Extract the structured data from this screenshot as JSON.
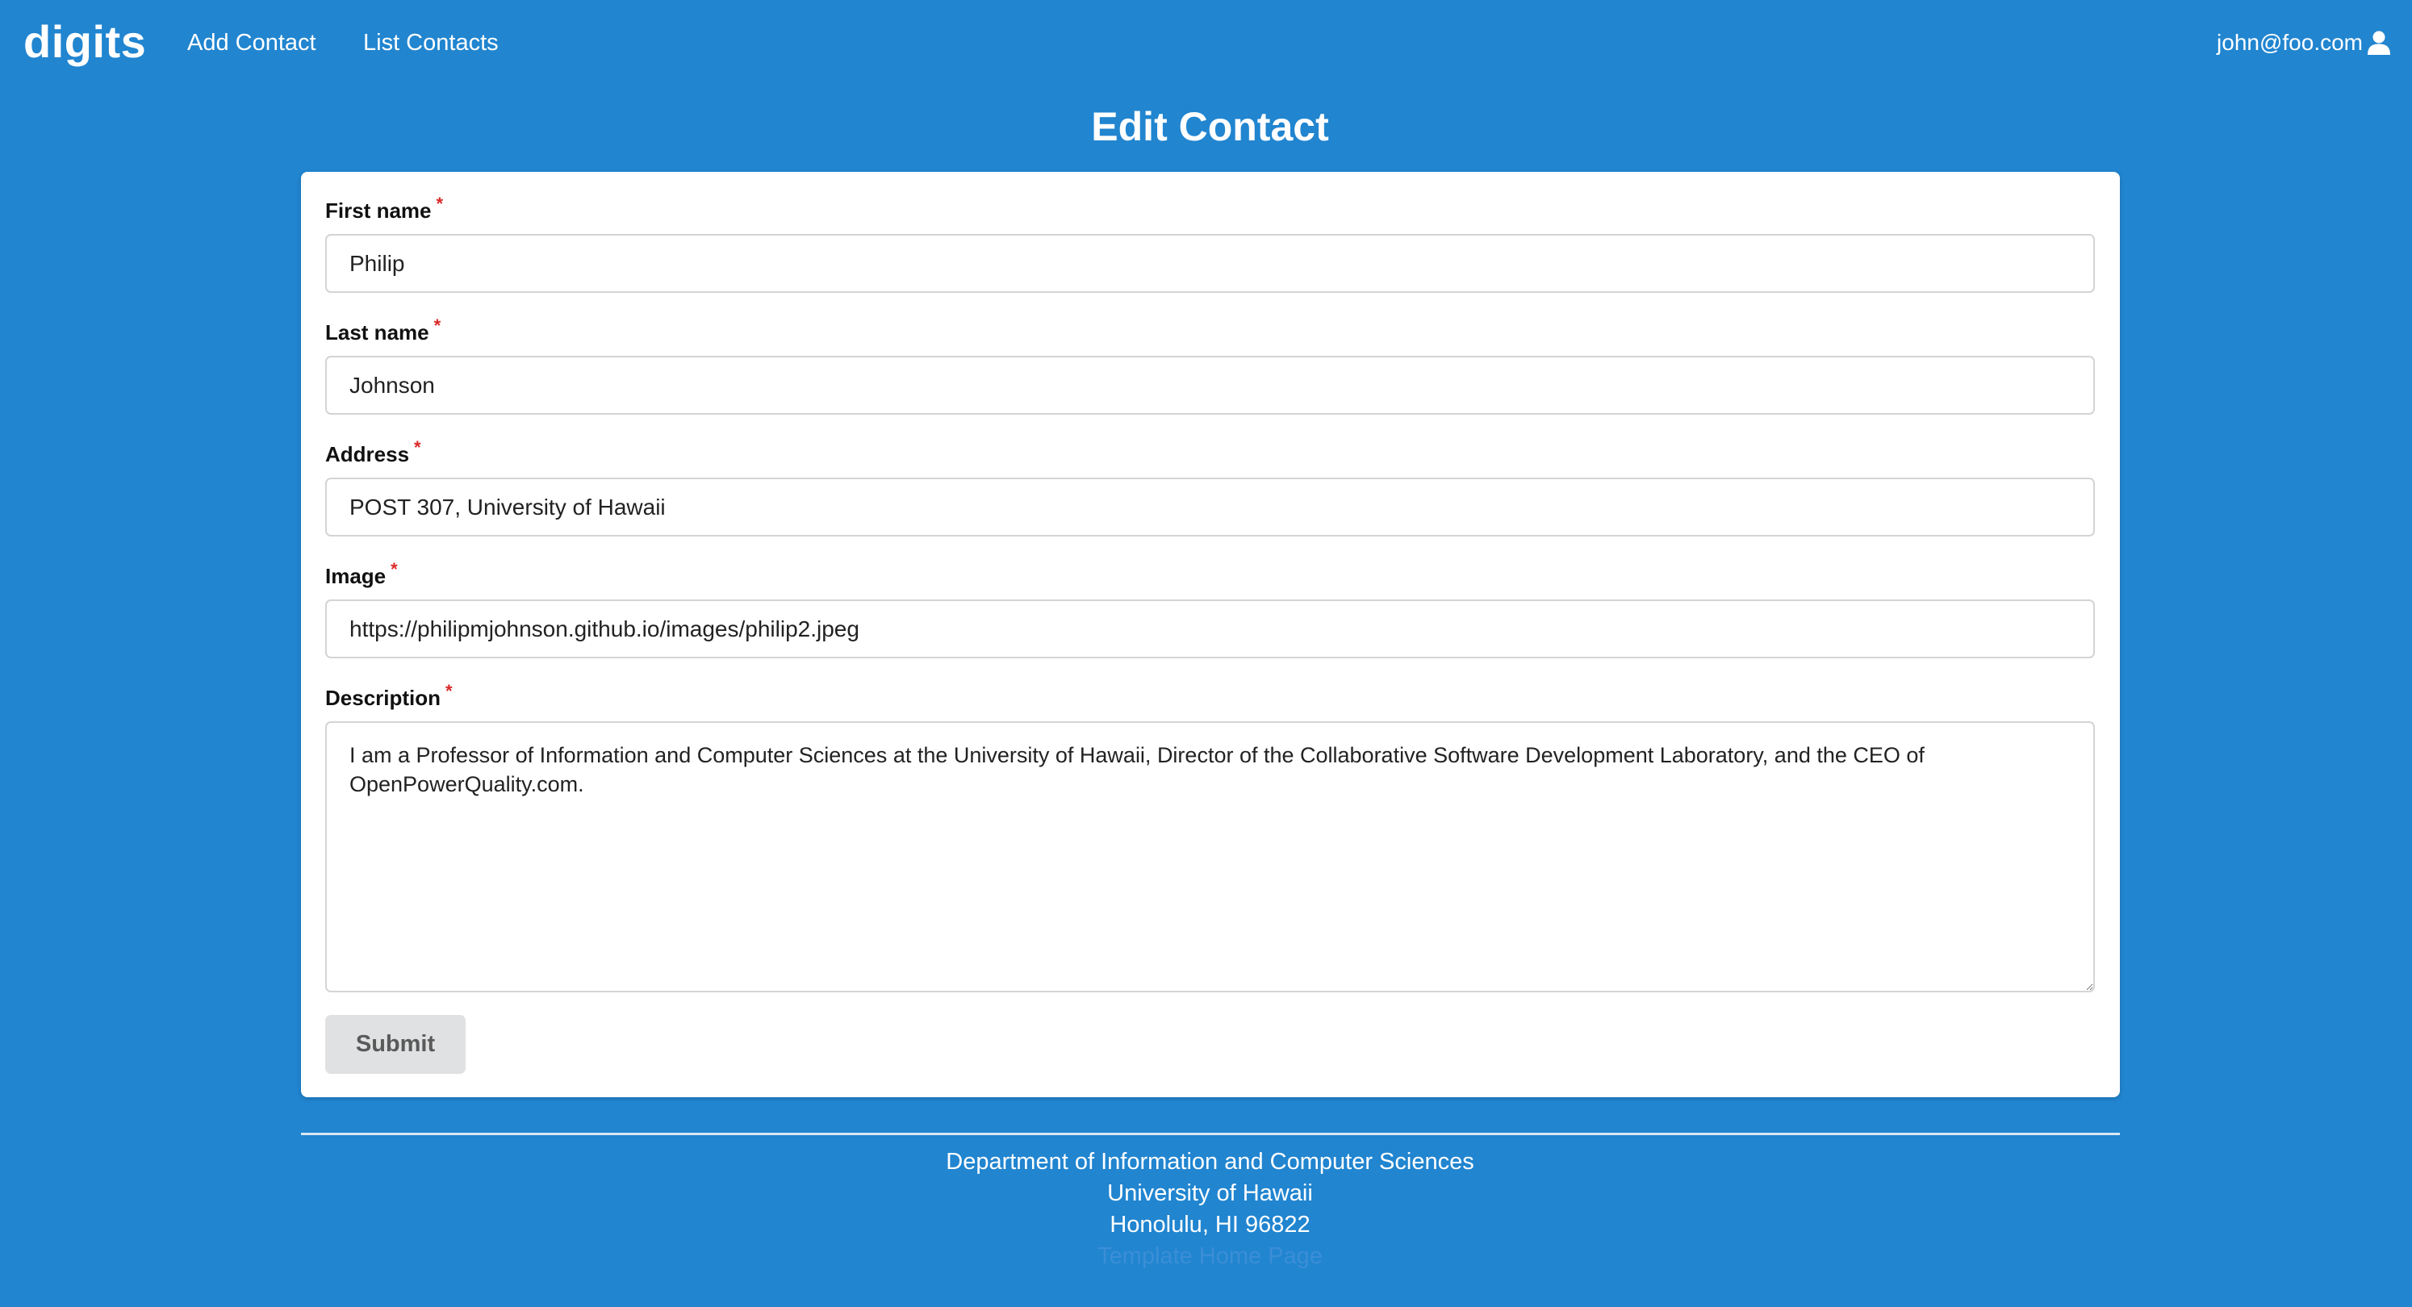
{
  "nav": {
    "brand": "digits",
    "links": [
      {
        "label": "Add Contact"
      },
      {
        "label": "List Contacts"
      }
    ],
    "user_email": "john@foo.com",
    "user_icon": "user-icon"
  },
  "page": {
    "title": "Edit Contact"
  },
  "form": {
    "required_marker": "*",
    "fields": [
      {
        "label": "First name",
        "value": "Philip"
      },
      {
        "label": "Last name",
        "value": "Johnson"
      },
      {
        "label": "Address",
        "value": "POST 307, University of Hawaii"
      },
      {
        "label": "Image",
        "value": "https://philipmjohnson.github.io/images/philip2.jpeg"
      },
      {
        "label": "Description",
        "value": "I am a Professor of Information and Computer Sciences at the University of Hawaii, Director of the Collaborative Software Development Laboratory, and the CEO of OpenPowerQuality.com."
      }
    ],
    "submit_label": "Submit"
  },
  "footer": {
    "lines": [
      "Department of Information and Computer Sciences",
      "University of Hawaii",
      "Honolulu, HI 96822"
    ],
    "link_label": "Template Home Page"
  },
  "colors": {
    "background": "#2185d0",
    "card": "#ffffff",
    "required": "#db2828",
    "button": "#e0e1e2"
  }
}
